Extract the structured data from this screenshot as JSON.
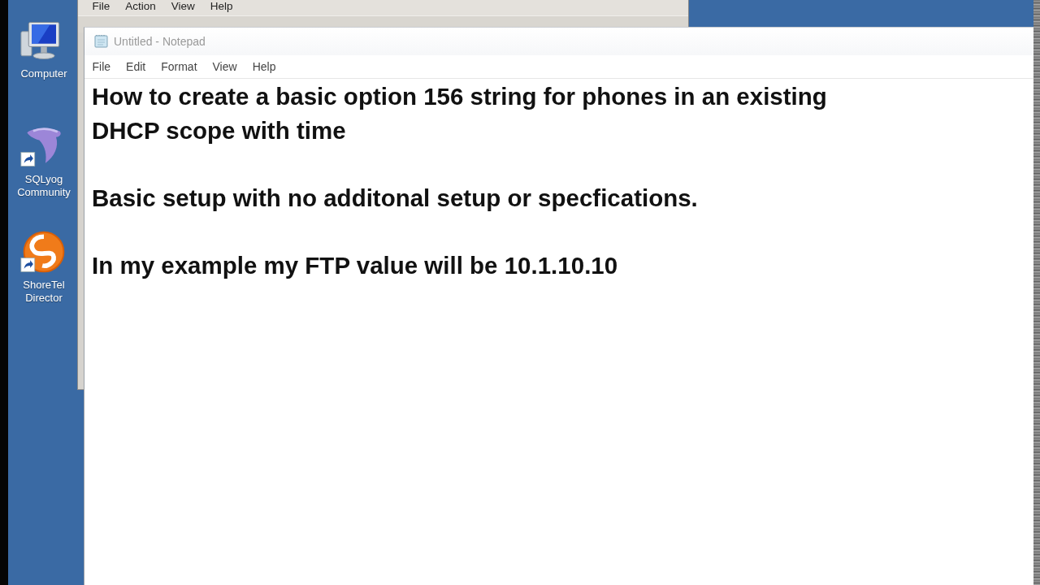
{
  "desktop": {
    "icons": [
      {
        "label": "Computer",
        "kind": "computer",
        "shortcut": false
      },
      {
        "label": "SQLyog Community",
        "kind": "dolphin",
        "shortcut": true
      },
      {
        "label": "ShoreTel Director",
        "kind": "swirl",
        "shortcut": true
      }
    ]
  },
  "background_window": {
    "menu": [
      "File",
      "Action",
      "View",
      "Help"
    ]
  },
  "notepad": {
    "title": "Untitled - Notepad",
    "menu": [
      "File",
      "Edit",
      "Format",
      "View",
      "Help"
    ],
    "paragraphs": [
      [
        "How to create a basic option 156 string for phones in an existing",
        "DHCP scope with time"
      ],
      [
        "Basic setup with no additonal setup or specfications."
      ],
      [
        "In my example my FTP value will be 10.1.10.10"
      ]
    ]
  }
}
